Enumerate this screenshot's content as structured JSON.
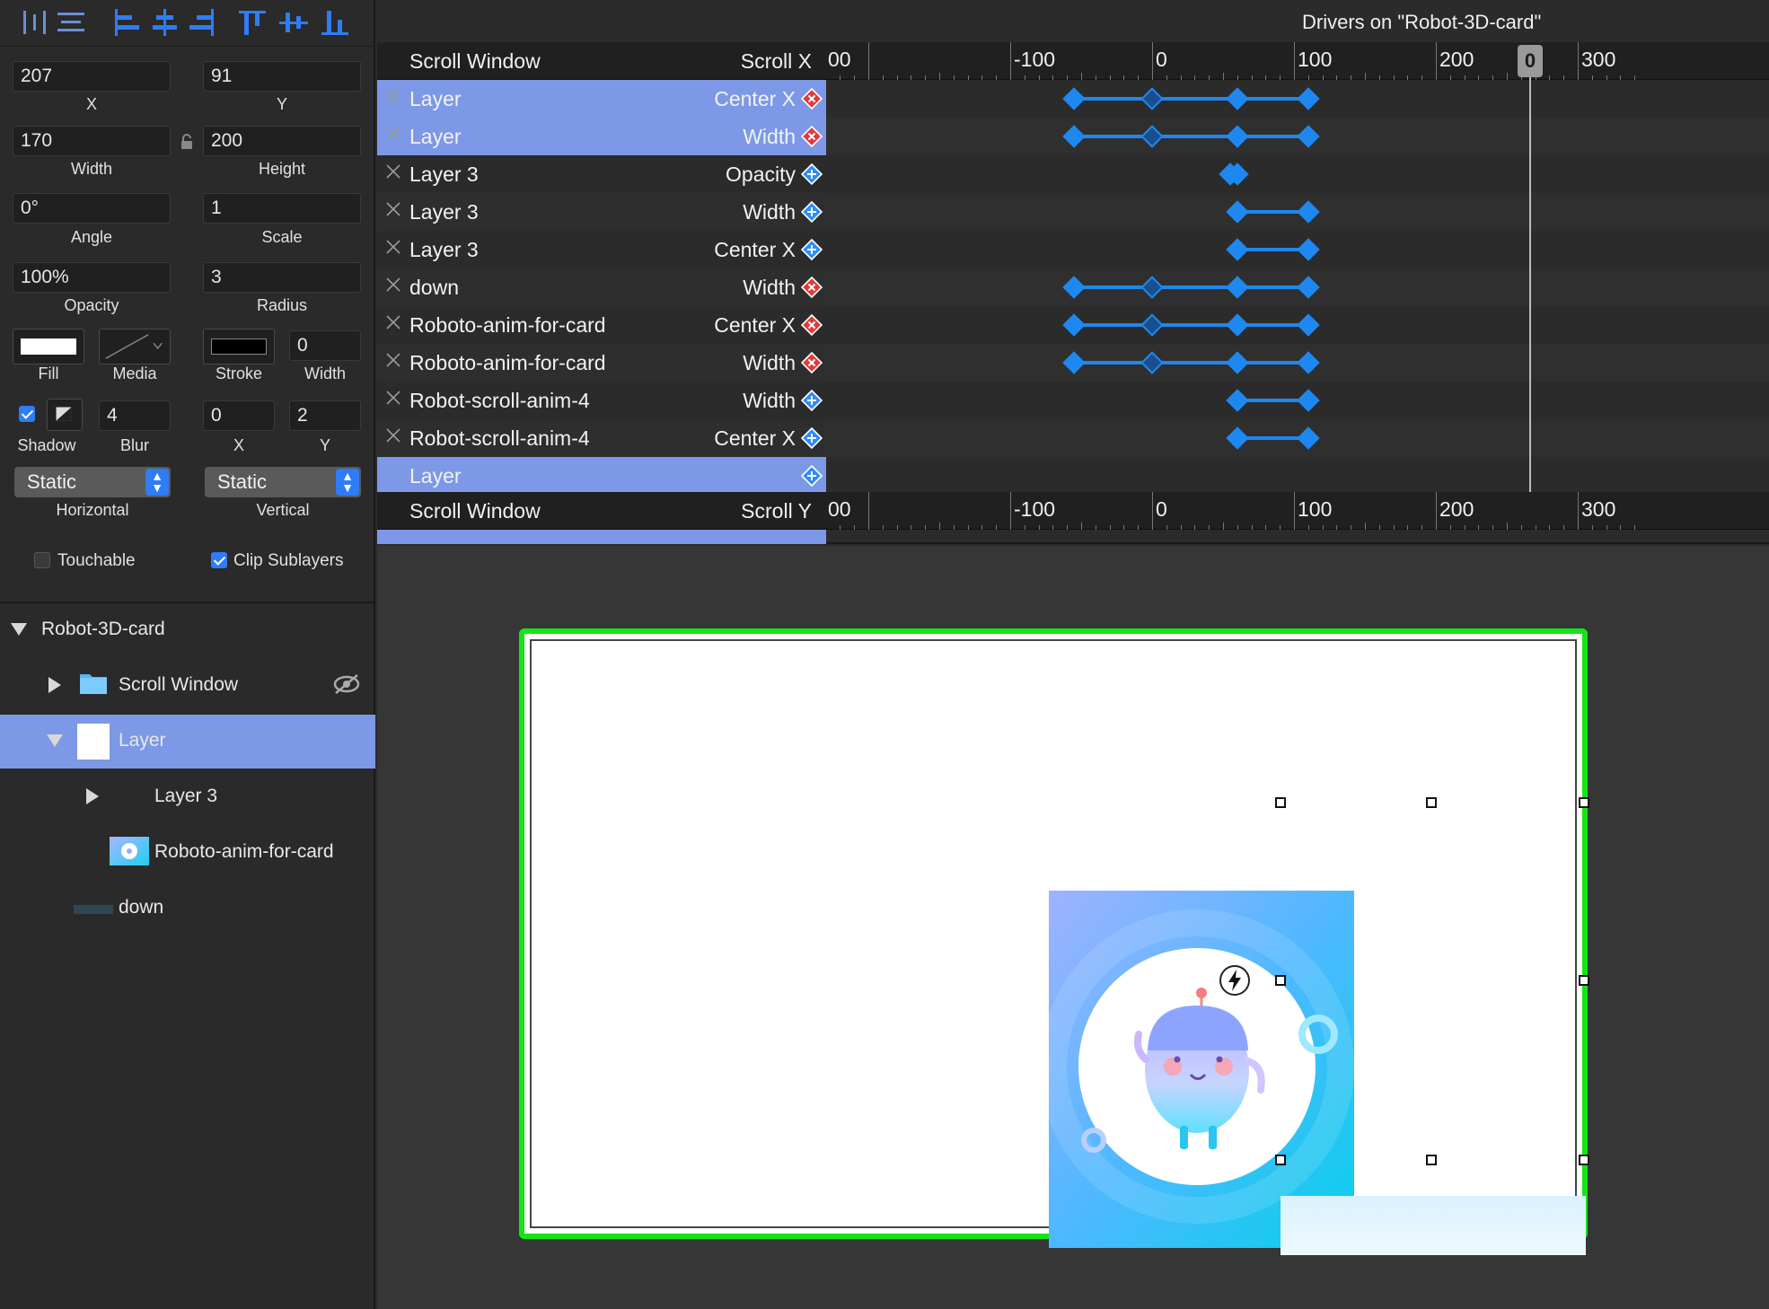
{
  "inspector": {
    "x": {
      "value": "207",
      "label": "X"
    },
    "y": {
      "value": "91",
      "label": "Y"
    },
    "width": {
      "value": "170",
      "label": "Width"
    },
    "height": {
      "value": "200",
      "label": "Height"
    },
    "angle": {
      "value": "0°",
      "label": "Angle"
    },
    "scale": {
      "value": "1",
      "label": "Scale"
    },
    "opacity": {
      "value": "100%",
      "label": "Opacity"
    },
    "radius": {
      "value": "3",
      "label": "Radius"
    },
    "fill_label": "Fill",
    "media_label": "Media",
    "stroke_label": "Stroke",
    "stroke_width": {
      "value": "0",
      "label": "Width"
    },
    "shadow_label": "Shadow",
    "blur": {
      "value": "4",
      "label": "Blur"
    },
    "shadow_x": {
      "value": "0",
      "label": "X"
    },
    "shadow_y": {
      "value": "2",
      "label": "Y"
    },
    "horizontal": {
      "value": "Static",
      "label": "Horizontal"
    },
    "vertical": {
      "value": "Static",
      "label": "Vertical"
    },
    "touchable": {
      "label": "Touchable",
      "checked": false
    },
    "clip_sublayers": {
      "label": "Clip Sublayers",
      "checked": true
    },
    "colors": {
      "fill": "#ffffff",
      "stroke": "#000000",
      "accent": "#2f7cf6"
    }
  },
  "layers": [
    {
      "name": "Robot-3D-card"
    },
    {
      "name": "Scroll Window"
    },
    {
      "name": "Layer"
    },
    {
      "name": "Layer 3"
    },
    {
      "name": "Roboto-anim-for-card"
    },
    {
      "name": "down"
    }
  ],
  "drivers": {
    "title": "Drivers on \"Robot-3D-card\"",
    "section1": {
      "name": "Scroll Window",
      "prop": "Scroll X"
    },
    "section2": {
      "name": "Scroll Window",
      "prop": "Scroll Y"
    },
    "ruler_labels": [
      "00",
      "-100",
      "0",
      "100",
      "200",
      "300"
    ],
    "playhead_label": "0",
    "rows": [
      {
        "name": "Layer",
        "prop": "Center X",
        "type": "red",
        "selected": true,
        "keys": [
          -55,
          0,
          60,
          110
        ]
      },
      {
        "name": "Layer",
        "prop": "Width",
        "type": "red",
        "selected": true,
        "keys": [
          -55,
          0,
          60,
          110
        ]
      },
      {
        "name": "Layer 3",
        "prop": "Opacity",
        "type": "blue",
        "selected": false,
        "keys": [
          55,
          60
        ]
      },
      {
        "name": "Layer 3",
        "prop": "Width",
        "type": "blue",
        "selected": false,
        "keys": [
          60,
          110
        ]
      },
      {
        "name": "Layer 3",
        "prop": "Center X",
        "type": "blue",
        "selected": false,
        "keys": [
          60,
          110
        ]
      },
      {
        "name": "down",
        "prop": "Width",
        "type": "red",
        "selected": false,
        "keys": [
          -55,
          0,
          60,
          110
        ]
      },
      {
        "name": "Roboto-anim-for-card",
        "prop": "Center X",
        "type": "red",
        "selected": false,
        "keys": [
          -55,
          0,
          60,
          110
        ]
      },
      {
        "name": "Roboto-anim-for-card",
        "prop": "Width",
        "type": "red",
        "selected": false,
        "keys": [
          -55,
          0,
          60,
          110
        ]
      },
      {
        "name": "Robot-scroll-anim-4",
        "prop": "Width",
        "type": "blue",
        "selected": false,
        "keys": [
          60,
          110
        ]
      },
      {
        "name": "Robot-scroll-anim-4",
        "prop": "Center X",
        "type": "blue",
        "selected": false,
        "keys": [
          60,
          110
        ]
      },
      {
        "name": "Layer",
        "prop": "",
        "type": "blue",
        "selected": true,
        "keys": []
      }
    ]
  }
}
